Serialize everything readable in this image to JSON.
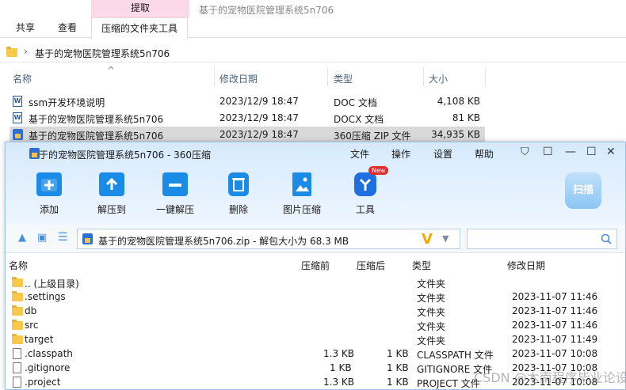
{
  "explorer": {
    "ribbon_context_label": "提取",
    "window_title": "基于的宠物医院管理系统5n706",
    "tabs": [
      "共享",
      "查看",
      "压缩的文件夹工具"
    ],
    "address_path": "基于的宠物医院管理系统5n706",
    "columns": {
      "name": "名称",
      "date": "修改日期",
      "type": "类型",
      "size": "大小"
    },
    "files": [
      {
        "name": "ssm开发环境说明",
        "date": "2023/12/9 18:47",
        "type": "DOC 文档",
        "size": "4,108 KB",
        "icon": "word-doc-icon"
      },
      {
        "name": "基于的宠物医院管理系统5n706",
        "date": "2023/12/9 18:47",
        "type": "DOCX 文档",
        "size": "81 KB",
        "icon": "word-doc-icon"
      },
      {
        "name": "基于的宠物医院管理系统5n706",
        "date": "2023/12/9 18:47",
        "type": "360压缩 ZIP 文件",
        "size": "34,935 KB",
        "icon": "zip-archive-icon"
      }
    ]
  },
  "zip_window": {
    "title": "基于的宠物医院管理系统5n706 - 360压缩",
    "menu": [
      "文件",
      "操作",
      "设置",
      "帮助"
    ],
    "toolbar": [
      {
        "label": "添加",
        "icon": "add-icon"
      },
      {
        "label": "解压到",
        "icon": "extract-to-icon"
      },
      {
        "label": "一键解压",
        "icon": "one-click-extract-icon"
      },
      {
        "label": "删除",
        "icon": "delete-icon"
      },
      {
        "label": "图片压缩",
        "icon": "image-compress-icon"
      },
      {
        "label": "工具",
        "icon": "tools-icon"
      }
    ],
    "new_badge": "New",
    "scan_label": "扫描",
    "path_text": "基于的宠物医院管理系统5n706.zip - 解包大小为 68.3 MB",
    "columns": {
      "name": "名称",
      "compressed_before": "压缩前",
      "compressed_after": "压缩后",
      "type": "类型",
      "date": "修改日期"
    },
    "rows": [
      {
        "name": ".. (上级目录)",
        "before": "",
        "after": "",
        "type": "文件夹",
        "date": "",
        "kind": "folder"
      },
      {
        "name": ".settings",
        "before": "",
        "after": "",
        "type": "文件夹",
        "date": "2023-11-07 11:46",
        "kind": "folder"
      },
      {
        "name": "db",
        "before": "",
        "after": "",
        "type": "文件夹",
        "date": "2023-11-07 11:46",
        "kind": "folder"
      },
      {
        "name": "src",
        "before": "",
        "after": "",
        "type": "文件夹",
        "date": "2023-11-07 11:46",
        "kind": "folder"
      },
      {
        "name": "target",
        "before": "",
        "after": "",
        "type": "文件夹",
        "date": "2023-11-07 11:49",
        "kind": "folder"
      },
      {
        "name": ".classpath",
        "before": "1.3 KB",
        "after": "1 KB",
        "type": "CLASSPATH 文件",
        "date": "2023-11-07 10:08",
        "kind": "file"
      },
      {
        "name": ".gitignore",
        "before": "1 KB",
        "after": "1 KB",
        "type": "GITIGNORE 文件",
        "date": "2023-11-07 10:08",
        "kind": "file"
      },
      {
        "name": ".project",
        "before": "1.3 KB",
        "after": "1 KB",
        "type": "PROJECT 文件",
        "date": "2023-11-07 10:08",
        "kind": "file"
      }
    ]
  },
  "watermark": "CSDN @木南程序毕业论设"
}
